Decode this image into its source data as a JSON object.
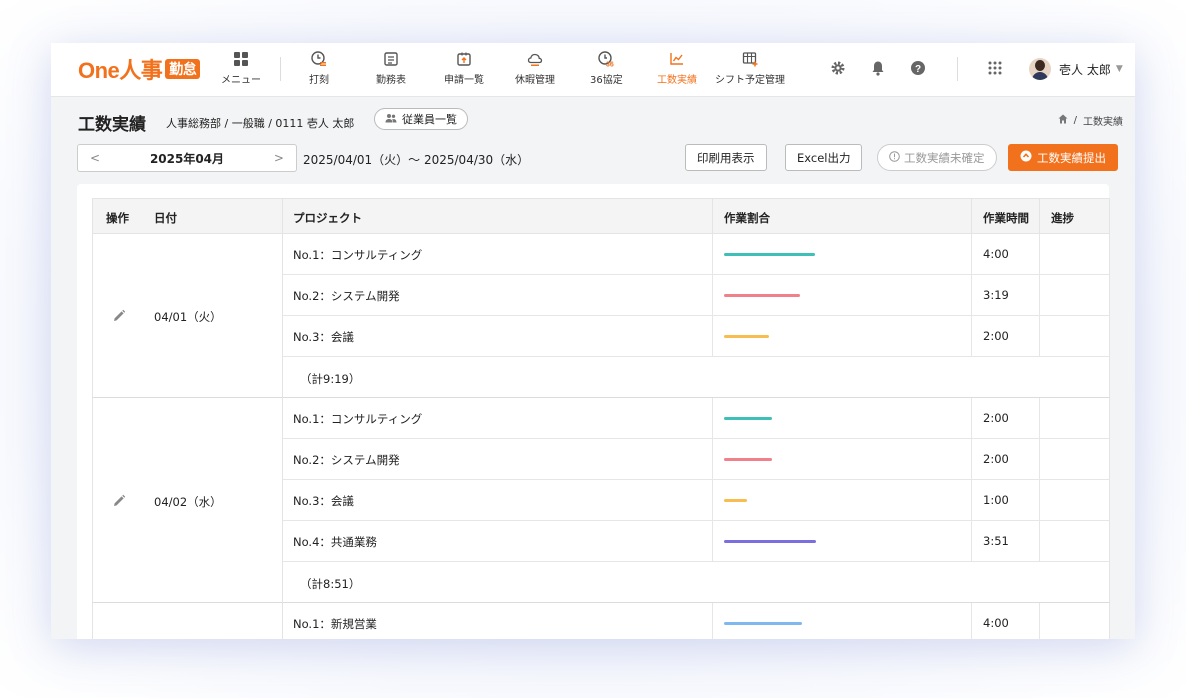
{
  "app": {
    "logo_text": "One人事",
    "logo_badge": "勤怠"
  },
  "nav": [
    {
      "label": "メニュー",
      "icon": "grid-menu-icon"
    },
    {
      "label": "打刻",
      "icon": "clock-stamp-icon"
    },
    {
      "label": "勤務表",
      "icon": "timesheet-icon"
    },
    {
      "label": "申請一覧",
      "icon": "application-list-icon"
    },
    {
      "label": "休暇管理",
      "icon": "leave-cloud-icon"
    },
    {
      "label": "36協定",
      "icon": "agreement-36-icon"
    },
    {
      "label": "工数実績",
      "icon": "work-hours-chart-icon",
      "active": true
    },
    {
      "label": "シフト予定管理",
      "icon": "shift-table-icon"
    }
  ],
  "header_icons": [
    "gear-icon",
    "bell-icon",
    "help-icon",
    "apps-grid-icon"
  ],
  "user": {
    "name": "壱人 太郎"
  },
  "page": {
    "title": "工数実績",
    "subtitle": "人事総務部 / 一般職 / 0111 壱人 太郎",
    "employee_list_button": "従業員一覧",
    "breadcrumb_home_icon": "home-icon",
    "breadcrumb_sep": "/",
    "breadcrumb_current": "工数実績"
  },
  "toolbar": {
    "month": "2025年04月",
    "prev_arrow": "<",
    "next_arrow": ">",
    "date_range": "2025/04/01（火）～ 2025/04/30（水）",
    "print_button": "印刷用表示",
    "excel_button": "Excel出力",
    "status_badge": "工数実績未確定",
    "submit_button": "工数実績提出"
  },
  "table": {
    "headers": {
      "action": "操作",
      "date": "日付",
      "project": "プロジェクト",
      "ratio": "作業割合",
      "hours": "作業時間",
      "progress": "進捗"
    },
    "groups": [
      {
        "date": "04/01（火）",
        "rows": [
          {
            "project": "No.1：コンサルティング",
            "hours": "4:00",
            "ratio": 0.43,
            "color": "#3ebfb8"
          },
          {
            "project": "No.2：システム開発",
            "hours": "3:19",
            "ratio": 0.36,
            "color": "#f0808a"
          },
          {
            "project": "No.3：会議",
            "hours": "2:00",
            "ratio": 0.21,
            "color": "#f7bd4f"
          }
        ],
        "total": "（計9:19）"
      },
      {
        "date": "04/02（水）",
        "rows": [
          {
            "project": "No.1：コンサルティング",
            "hours": "2:00",
            "ratio": 0.225,
            "color": "#3ebfb8"
          },
          {
            "project": "No.2：システム開発",
            "hours": "2:00",
            "ratio": 0.225,
            "color": "#f0808a"
          },
          {
            "project": "No.3：会議",
            "hours": "1:00",
            "ratio": 0.11,
            "color": "#f7bd4f"
          },
          {
            "project": "No.4：共通業務",
            "hours": "3:51",
            "ratio": 0.435,
            "color": "#7b6fe0"
          }
        ],
        "total": "（計8:51）"
      },
      {
        "date": "",
        "rows": [
          {
            "project": "No.1：新規営業",
            "hours": "4:00",
            "ratio": 0.37,
            "color": "#7fb8ee"
          }
        ],
        "total": ""
      }
    ]
  }
}
